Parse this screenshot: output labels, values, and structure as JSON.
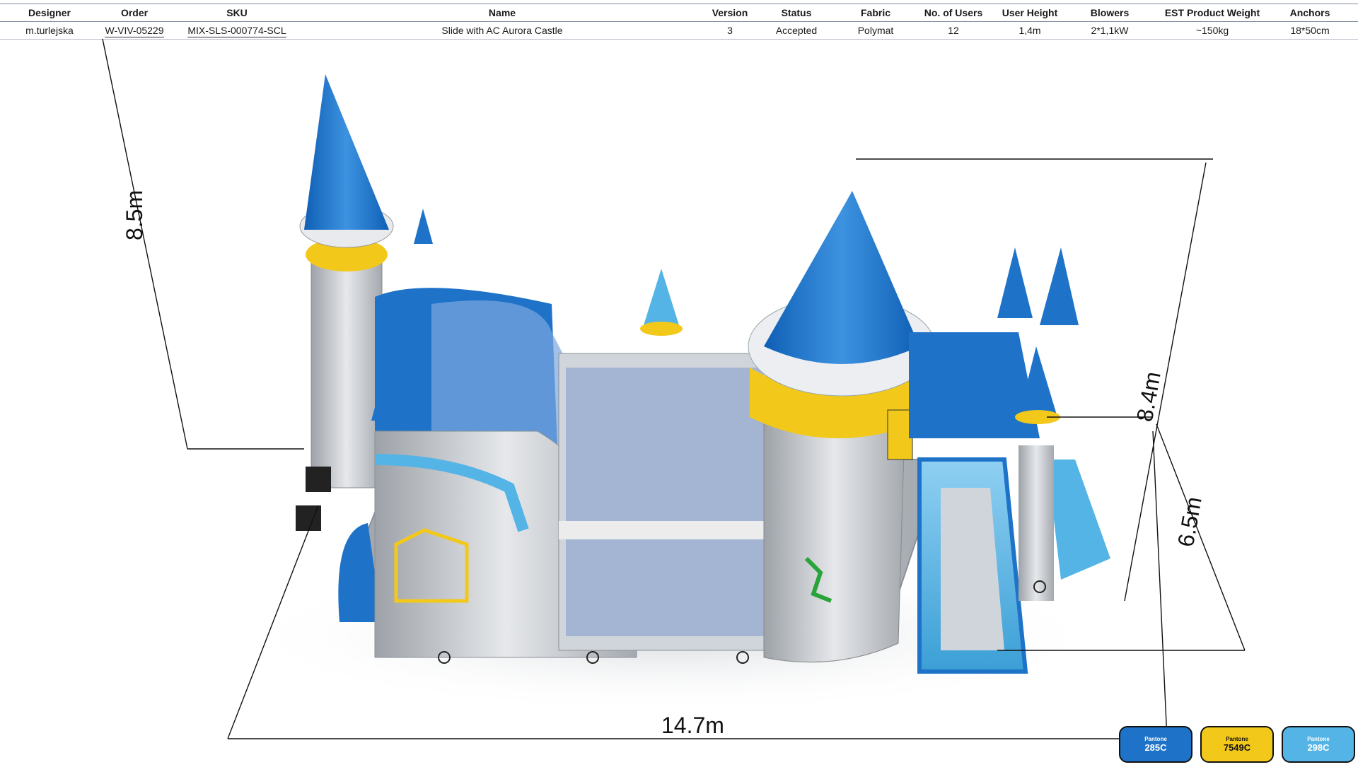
{
  "spec_table": {
    "headers": [
      "Designer",
      "Order",
      "SKU",
      "Name",
      "Version",
      "Status",
      "Fabric",
      "No. of Users",
      "User  Height",
      "Blowers",
      "EST Product Weight",
      "Anchors"
    ],
    "values": [
      "m.turlejska",
      "W-VIV-05229",
      "MIX-SLS-000774-SCL",
      "Slide with AC Aurora Castle",
      "3",
      "Accepted",
      "Polymat",
      "12",
      "1,4m",
      "2*1,1kW",
      "~150kg",
      "18*50cm"
    ]
  },
  "dimensions": {
    "height_left": "8.5m",
    "height_right": "8.4m",
    "depth": "6.5m",
    "length": "14.7m"
  },
  "swatches": [
    {
      "label": "Pantone",
      "code": "285C",
      "color": "#1e73c8",
      "text_color": "#ffffff"
    },
    {
      "label": "Pantone",
      "code": "7549C",
      "color": "#f2c81a",
      "text_color": "#111111"
    },
    {
      "label": "Pantone",
      "code": "298C",
      "color": "#55b4e6",
      "text_color": "#ffffff"
    }
  ],
  "colors": {
    "blue": "#1e73c8",
    "light_blue": "#55b4e6",
    "yellow": "#f2c81a",
    "grey": "#c8cbd0"
  }
}
